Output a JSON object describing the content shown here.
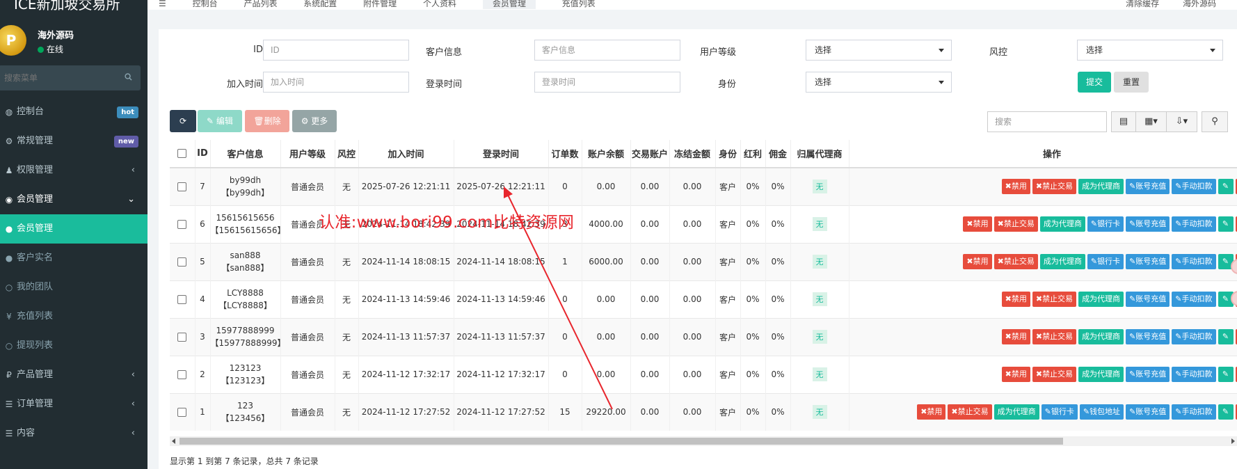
{
  "sidebar": {
    "brand": "ICE新加坡交易所",
    "avatar_letter": "P",
    "user_name": "海外源码",
    "user_status": "在线",
    "search_placeholder": "搜索菜单",
    "items": [
      {
        "label": "控制台",
        "icon": "dashboard-icon",
        "badge": "hot"
      },
      {
        "label": "常规管理",
        "icon": "cogs-icon",
        "badge": "new"
      },
      {
        "label": "权限管理",
        "icon": "group-icon"
      },
      {
        "label": "会员管理",
        "icon": "user-circle-icon"
      },
      {
        "label": "会员管理",
        "icon": "user-icon"
      },
      {
        "label": "客户实名",
        "icon": "user-icon"
      },
      {
        "label": "我的团队",
        "icon": "circle-icon"
      },
      {
        "label": "充值列表",
        "icon": "yen-icon"
      },
      {
        "label": "提现列表",
        "icon": "circle-icon"
      },
      {
        "label": "产品管理",
        "icon": "ruble-icon"
      },
      {
        "label": "订单管理",
        "icon": "list-icon"
      },
      {
        "label": "内容",
        "icon": "list-icon"
      }
    ]
  },
  "topnav": {
    "tabs": [
      "控制台",
      "产品列表",
      "系统配置",
      "附件管理",
      "个人资料",
      "会员管理",
      "充值列表"
    ],
    "right": [
      "清除缓存",
      "海外源码"
    ]
  },
  "filters": {
    "id_label": "ID",
    "id_placeholder": "ID",
    "customer_label": "客户信息",
    "customer_placeholder": "客户信息",
    "level_label": "用户等级",
    "level_value": "选择",
    "risk_label": "风控",
    "risk_value": "选择",
    "join_label": "加入时间",
    "join_placeholder": "加入时间",
    "login_label": "登录时间",
    "login_placeholder": "登录时间",
    "identity_label": "身份",
    "identity_value": "选择",
    "submit": "提交",
    "reset": "重置"
  },
  "toolbar": {
    "edit": "编辑",
    "delete": "删除",
    "more": "更多",
    "search_placeholder": "搜索"
  },
  "table": {
    "headers": [
      "ID",
      "客户信息",
      "用户等级",
      "风控",
      "加入时间",
      "登录时间",
      "订单数",
      "账户余额",
      "交易账户",
      "冻结金额",
      "身份",
      "红利",
      "佣金",
      "归属代理商",
      "操作"
    ],
    "rows": [
      {
        "id": "7",
        "name": "by99dh",
        "account": "【by99dh】",
        "level": "普通会员",
        "risk": "无",
        "joined": "2025-07-26 12:21:11",
        "login": "2025-07-26 12:21:11",
        "orders": "0",
        "balance": "0.00",
        "trade": "0.00",
        "frozen": "0.00",
        "identity": "客户",
        "bonus": "0%",
        "commission": "0%",
        "agent": "无",
        "ops": [
          "禁用",
          "禁止交易",
          "成为代理商",
          "账号充值",
          "手动扣款"
        ]
      },
      {
        "id": "6",
        "name": "15615615656",
        "account": "【15615615656】",
        "level": "普通会员",
        "risk": "无",
        "joined": "2024-11-14 18:42:39",
        "login": "2024-11-14 18:42:39",
        "orders": "3",
        "balance": "4000.00",
        "trade": "0.00",
        "frozen": "0.00",
        "identity": "客户",
        "bonus": "0%",
        "commission": "0%",
        "agent": "无",
        "ops": [
          "禁用",
          "禁止交易",
          "成为代理商",
          "银行卡",
          "账号充值",
          "手动扣款"
        ]
      },
      {
        "id": "5",
        "name": "san888",
        "account": "【san888】",
        "level": "普通会员",
        "risk": "无",
        "joined": "2024-11-14 18:08:15",
        "login": "2024-11-14 18:08:15",
        "orders": "1",
        "balance": "6000.00",
        "trade": "0.00",
        "frozen": "0.00",
        "identity": "客户",
        "bonus": "0%",
        "commission": "0%",
        "agent": "无",
        "ops": [
          "禁用",
          "禁止交易",
          "成为代理商",
          "银行卡",
          "账号充值",
          "手动扣款"
        ]
      },
      {
        "id": "4",
        "name": "LCY8888",
        "account": "【LCY8888】",
        "level": "普通会员",
        "risk": "无",
        "joined": "2024-11-13 14:59:46",
        "login": "2024-11-13 14:59:46",
        "orders": "0",
        "balance": "0.00",
        "trade": "0.00",
        "frozen": "0.00",
        "identity": "客户",
        "bonus": "0%",
        "commission": "0%",
        "agent": "无",
        "ops": [
          "禁用",
          "禁止交易",
          "成为代理商",
          "账号充值",
          "手动扣款"
        ]
      },
      {
        "id": "3",
        "name": "15977888999",
        "account": "【15977888999】",
        "level": "普通会员",
        "risk": "无",
        "joined": "2024-11-13 11:57:37",
        "login": "2024-11-13 11:57:37",
        "orders": "0",
        "balance": "0.00",
        "trade": "0.00",
        "frozen": "0.00",
        "identity": "客户",
        "bonus": "0%",
        "commission": "0%",
        "agent": "无",
        "ops": [
          "禁用",
          "禁止交易",
          "成为代理商",
          "账号充值",
          "手动扣款"
        ]
      },
      {
        "id": "2",
        "name": "123123",
        "account": "【123123】",
        "level": "普通会员",
        "risk": "无",
        "joined": "2024-11-12 17:32:17",
        "login": "2024-11-12 17:32:17",
        "orders": "0",
        "balance": "0.00",
        "trade": "0.00",
        "frozen": "0.00",
        "identity": "客户",
        "bonus": "0%",
        "commission": "0%",
        "agent": "无",
        "ops": [
          "禁用",
          "禁止交易",
          "成为代理商",
          "账号充值",
          "手动扣款"
        ]
      },
      {
        "id": "1",
        "name": "123",
        "account": "【123456】",
        "level": "普通会员",
        "risk": "无",
        "joined": "2024-11-12 17:27:52",
        "login": "2024-11-12 17:27:52",
        "orders": "15",
        "balance": "29220.00",
        "trade": "0.00",
        "frozen": "0.00",
        "identity": "客户",
        "bonus": "0%",
        "commission": "0%",
        "agent": "无",
        "ops": [
          "禁用",
          "禁止交易",
          "成为代理商",
          "银行卡",
          "钱包地址",
          "账号充值",
          "手动扣款"
        ]
      }
    ]
  },
  "pagination_info": "显示第 1 到第 7 条记录，总共 7 条记录",
  "watermark": "认准:www.bori99.com比特资源网",
  "colors": {
    "sidebar_bg": "#222d32",
    "accent_green": "#18bc9c",
    "danger_red": "#e74c3c",
    "info_blue": "#3498db",
    "watermark_red": "#e8262d"
  }
}
